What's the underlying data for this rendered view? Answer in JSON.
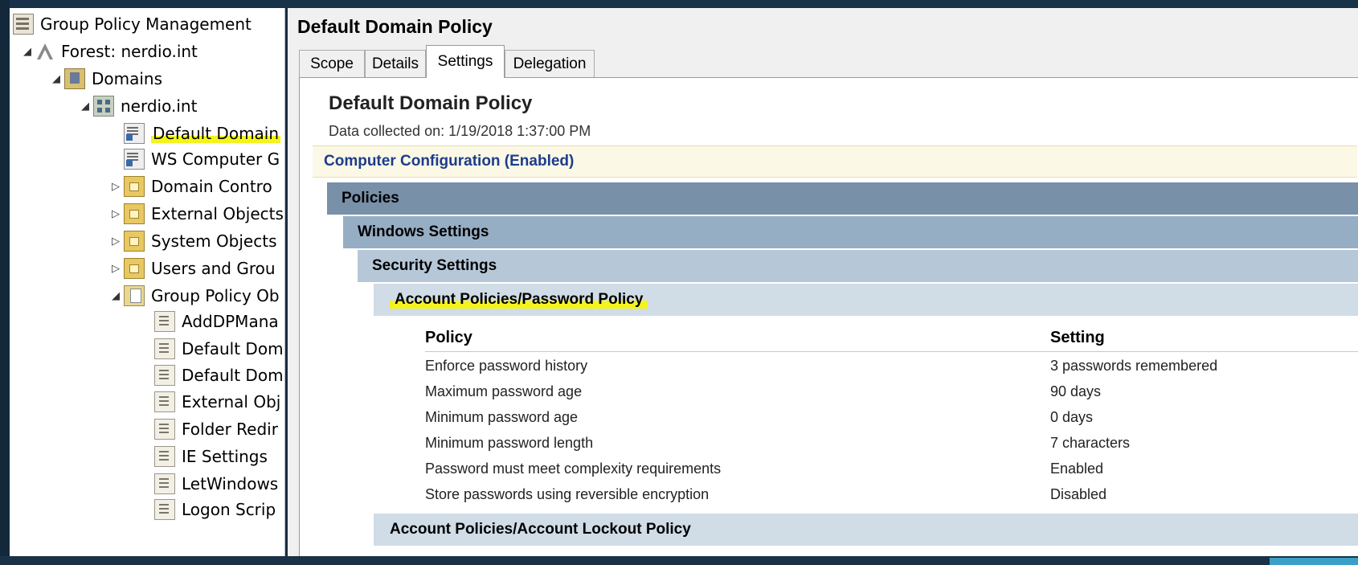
{
  "tree": {
    "items": [
      {
        "label": "Group Policy Management",
        "icon": "gpm-console-icon",
        "expander": "",
        "highlighted": false
      },
      {
        "label": "Forest: nerdio.int",
        "icon": "forest-icon",
        "expander": "◢",
        "highlighted": false
      },
      {
        "label": "Domains",
        "icon": "domains-icon",
        "expander": "◢",
        "highlighted": false
      },
      {
        "label": "nerdio.int",
        "icon": "domain-icon",
        "expander": "◢",
        "highlighted": false
      },
      {
        "label": "Default Domain",
        "icon": "gpo-link-icon",
        "expander": "",
        "highlighted": true
      },
      {
        "label": "WS Computer G",
        "icon": "gpo-link-icon",
        "expander": "",
        "highlighted": false
      },
      {
        "label": "Domain Contro",
        "icon": "ou-folder-icon",
        "expander": "▷",
        "highlighted": false
      },
      {
        "label": "External Objects",
        "icon": "ou-folder-icon",
        "expander": "▷",
        "highlighted": false
      },
      {
        "label": "System Objects",
        "icon": "ou-folder-icon",
        "expander": "▷",
        "highlighted": false
      },
      {
        "label": "Users and Grou",
        "icon": "ou-folder-icon",
        "expander": "▷",
        "highlighted": false
      },
      {
        "label": "Group Policy Ob",
        "icon": "gpo-container-icon",
        "expander": "◢",
        "highlighted": false
      },
      {
        "label": "AddDPMana",
        "icon": "gpo-icon",
        "expander": "",
        "highlighted": false
      },
      {
        "label": "Default Dom",
        "icon": "gpo-icon",
        "expander": "",
        "highlighted": false
      },
      {
        "label": "Default Dom",
        "icon": "gpo-icon",
        "expander": "",
        "highlighted": false
      },
      {
        "label": "External Obj",
        "icon": "gpo-icon",
        "expander": "",
        "highlighted": false
      },
      {
        "label": "Folder Redir",
        "icon": "gpo-icon",
        "expander": "",
        "highlighted": false
      },
      {
        "label": "IE Settings",
        "icon": "gpo-icon",
        "expander": "",
        "highlighted": false
      },
      {
        "label": "LetWindows",
        "icon": "gpo-icon",
        "expander": "",
        "highlighted": false
      },
      {
        "label": "Logon Scrip",
        "icon": "gpo-icon",
        "expander": "",
        "highlighted": false
      }
    ]
  },
  "main": {
    "title": "Default Domain Policy",
    "tabs": [
      {
        "label": "Scope",
        "active": false
      },
      {
        "label": "Details",
        "active": false
      },
      {
        "label": "Settings",
        "active": true
      },
      {
        "label": "Delegation",
        "active": false
      }
    ]
  },
  "report": {
    "title": "Default Domain Policy",
    "collected": "Data collected on: 1/19/2018 1:37:00 PM",
    "computer_config": "Computer Configuration (Enabled)",
    "policies": "Policies",
    "windows_settings": "Windows Settings",
    "security_settings": "Security Settings",
    "account_password": "Account Policies/Password Policy",
    "account_lockout": "Account Policies/Account Lockout Policy",
    "columns": {
      "policy": "Policy",
      "setting": "Setting"
    },
    "rows": [
      {
        "policy": "Enforce password history",
        "setting": "3 passwords remembered"
      },
      {
        "policy": "Maximum password age",
        "setting": "90 days"
      },
      {
        "policy": "Minimum password age",
        "setting": "0 days"
      },
      {
        "policy": "Minimum password length",
        "setting": "7 characters"
      },
      {
        "policy": "Password must meet complexity requirements",
        "setting": "Enabled"
      },
      {
        "policy": "Store passwords using reversible encryption",
        "setting": "Disabled"
      }
    ]
  },
  "colors": {
    "highlight": "#f4f41c",
    "computer_config_text": "#1c3c8c",
    "band_policies": "#7890a8",
    "band_windows": "#96aec4",
    "band_security": "#b6c8d8",
    "band_account": "#d0dce6"
  }
}
